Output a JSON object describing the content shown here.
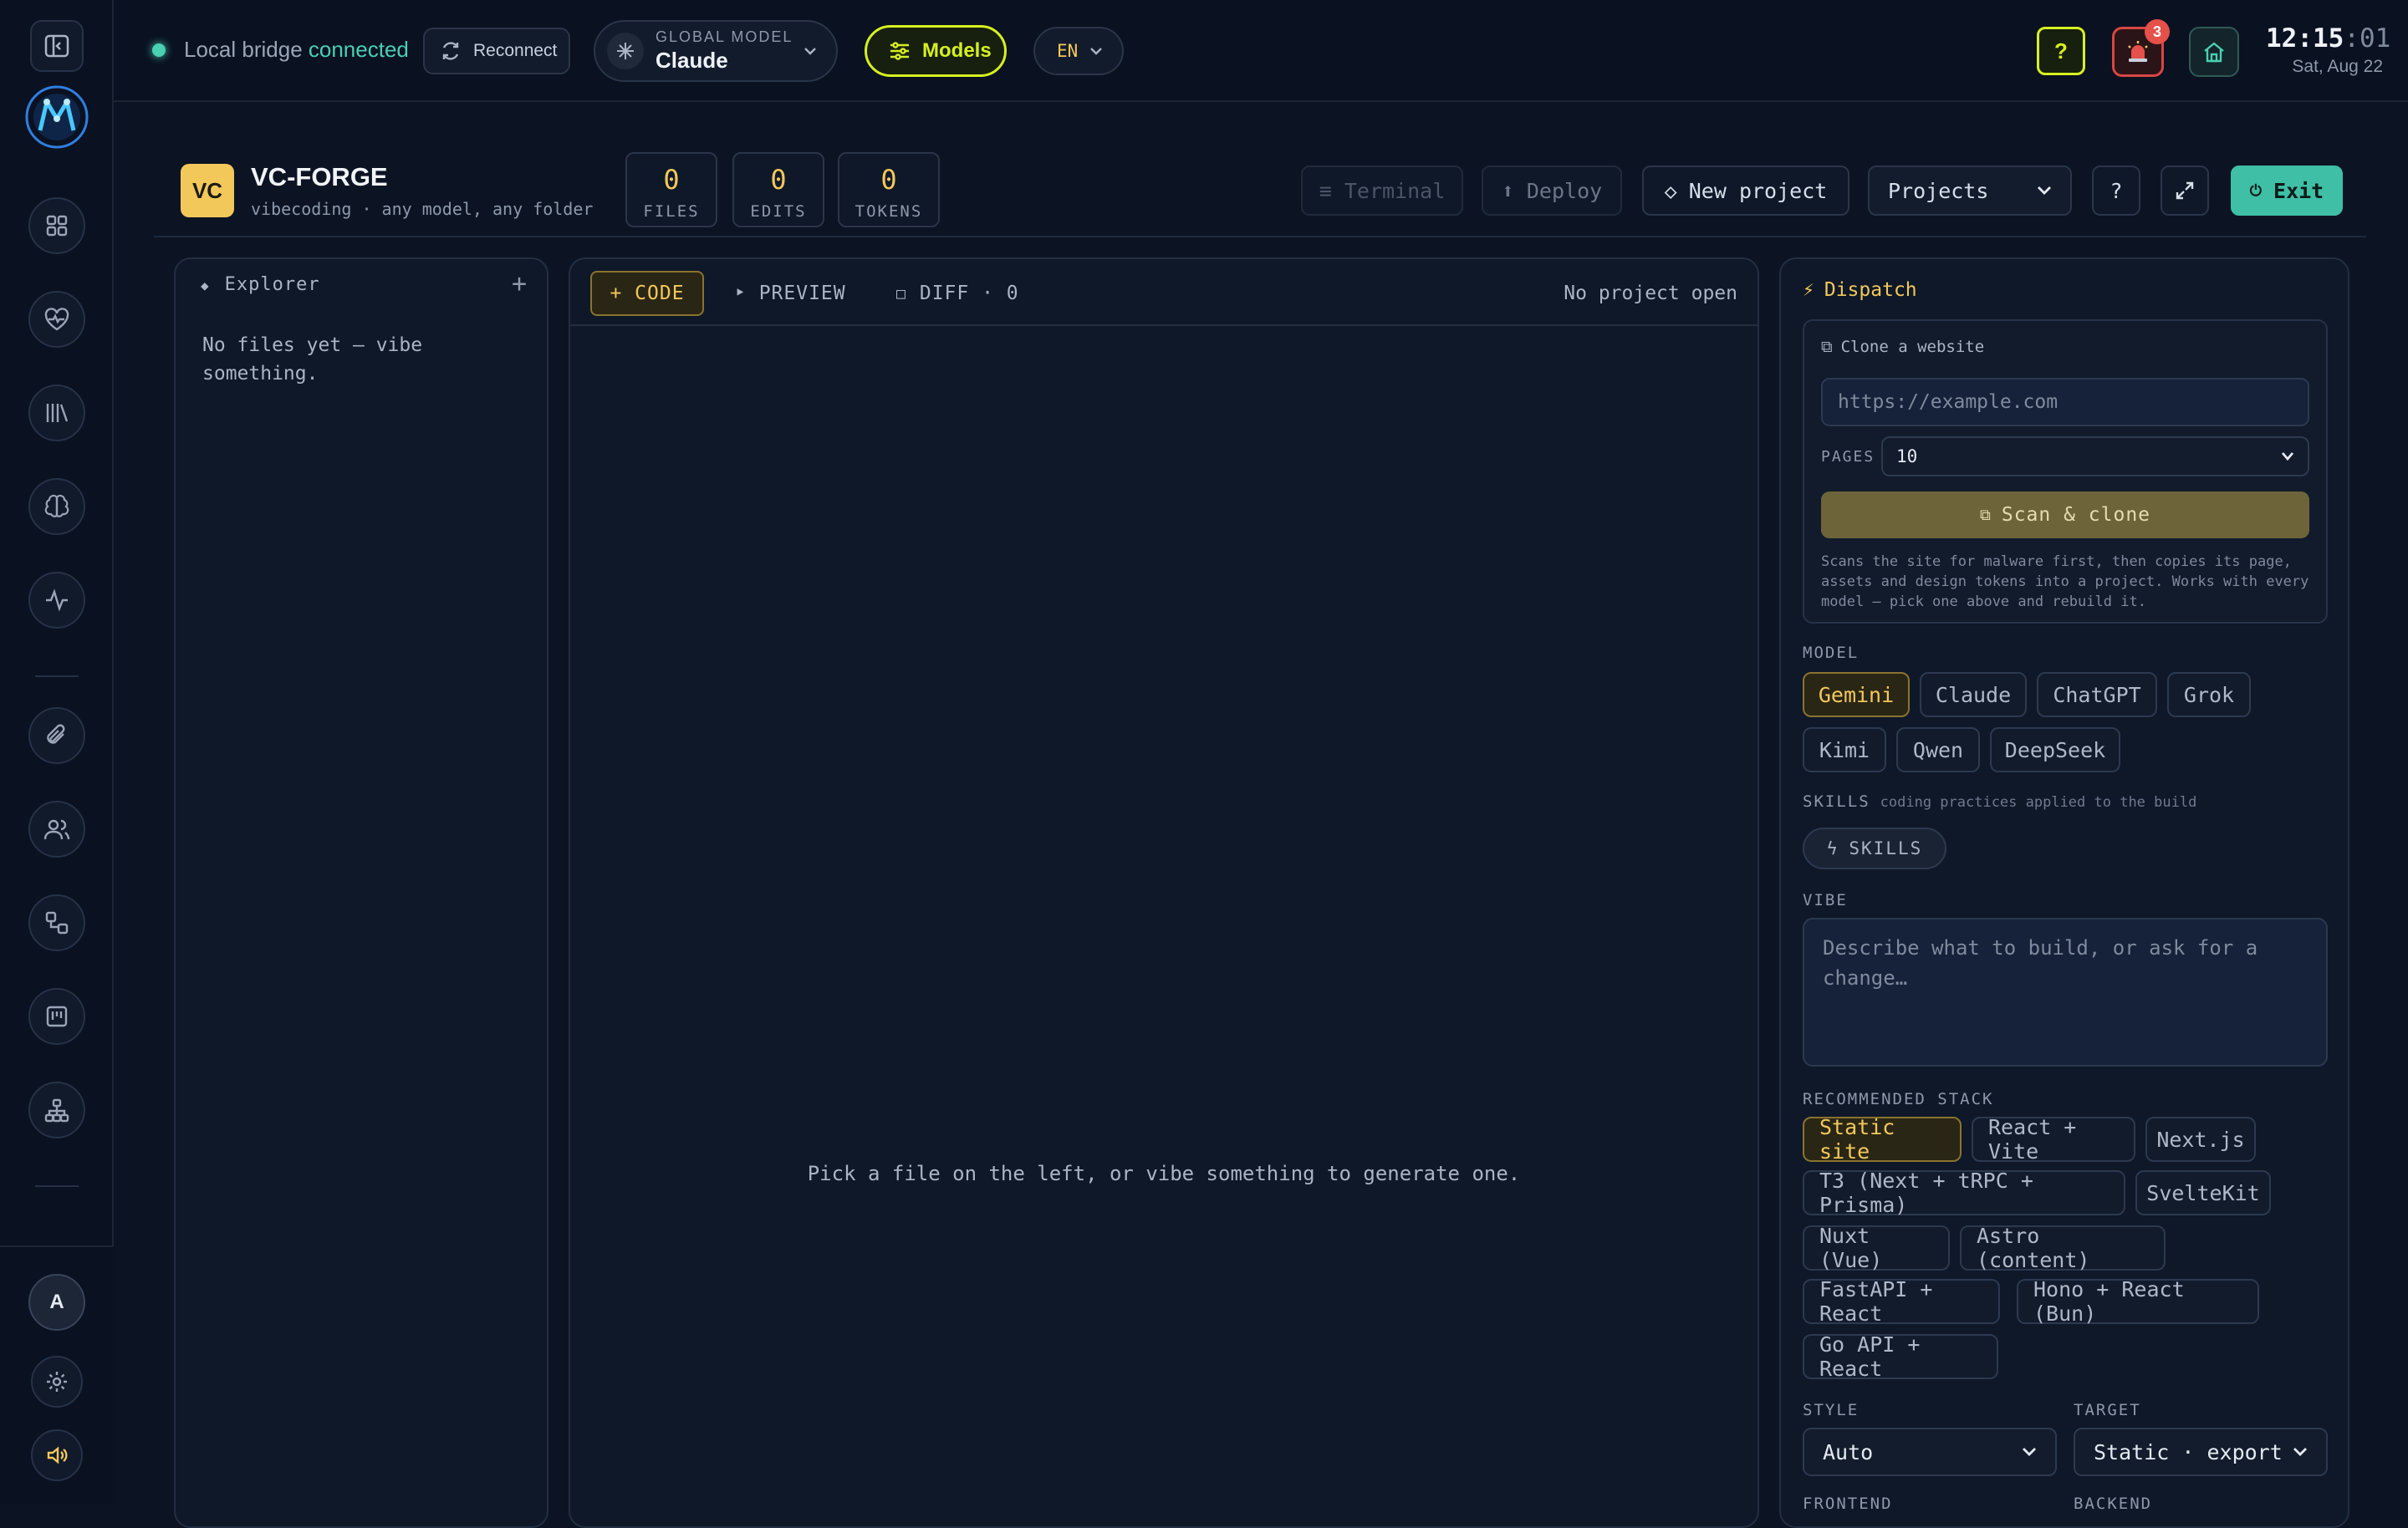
{
  "topbar": {
    "bridge_label": "Local bridge",
    "bridge_status": "connected",
    "reconnect": "Reconnect",
    "global_model_label": "GLOBAL MODEL",
    "global_model_value": "Claude",
    "models_button": "Models",
    "language": "EN",
    "help": "?",
    "alerts_count": "3",
    "clock_hm": "12:15",
    "clock_s": ":01",
    "date": "Sat, Aug 22"
  },
  "user": {
    "avatar_initial": "A"
  },
  "project": {
    "badge": "VC",
    "name": "VC-FORGE",
    "tagline": "vibecoding · any model, any folder",
    "stats": [
      {
        "value": "0",
        "label": "FILES"
      },
      {
        "value": "0",
        "label": "EDITS"
      },
      {
        "value": "0",
        "label": "TOKENS"
      }
    ],
    "terminal": "≡ Terminal",
    "deploy": "⬆ Deploy",
    "new_project": "New project",
    "projects_select": "Projects",
    "help": "?",
    "exit": "Exit"
  },
  "explorer": {
    "title": "Explorer",
    "add": "+",
    "empty": "No files yet — vibe something."
  },
  "editor": {
    "tab_code": "+ CODE",
    "tab_preview": "‣ PREVIEW",
    "tab_diff": "DIFF · 0",
    "status": "No project open",
    "empty": "Pick a file on the left, or vibe something to generate one."
  },
  "dispatch": {
    "title": "Dispatch",
    "clone_title": "Clone a website",
    "url_placeholder": "https://example.com",
    "pages_label": "PAGES",
    "pages_value": "10",
    "scan_button": "Scan & clone",
    "clone_help": "Scans the site for malware first, then copies its page, assets and design tokens into a project. Works with every model — pick one above and rebuild it.",
    "model_label": "MODEL",
    "models": [
      "Gemini",
      "Claude",
      "ChatGPT",
      "Grok",
      "Kimi",
      "Qwen",
      "DeepSeek"
    ],
    "skills_label": "SKILLS",
    "skills_hint": "coding practices applied to the build",
    "skills_button": "SKILLS",
    "vibe_label": "VIBE",
    "vibe_placeholder": "Describe what to build, or ask for a change…",
    "stack_label": "RECOMMENDED STACK",
    "stacks": [
      "Static site",
      "React + Vite",
      "Next.js",
      "T3 (Next + tRPC + Prisma)",
      "SvelteKit",
      "Nuxt (Vue)",
      "Astro (content)",
      "FastAPI + React",
      "Hono + React (Bun)",
      "Go API + React"
    ],
    "style_label": "STYLE",
    "style_value": "Auto",
    "target_label": "TARGET",
    "target_value": "Static · export",
    "frontend_label": "FRONTEND",
    "backend_label": "BACKEND"
  },
  "colors": {
    "accent_yellow": "#f2c85b",
    "accent_teal": "#4ad0b3",
    "models_lime": "#d6f01f",
    "alert_red": "#e4504a"
  }
}
